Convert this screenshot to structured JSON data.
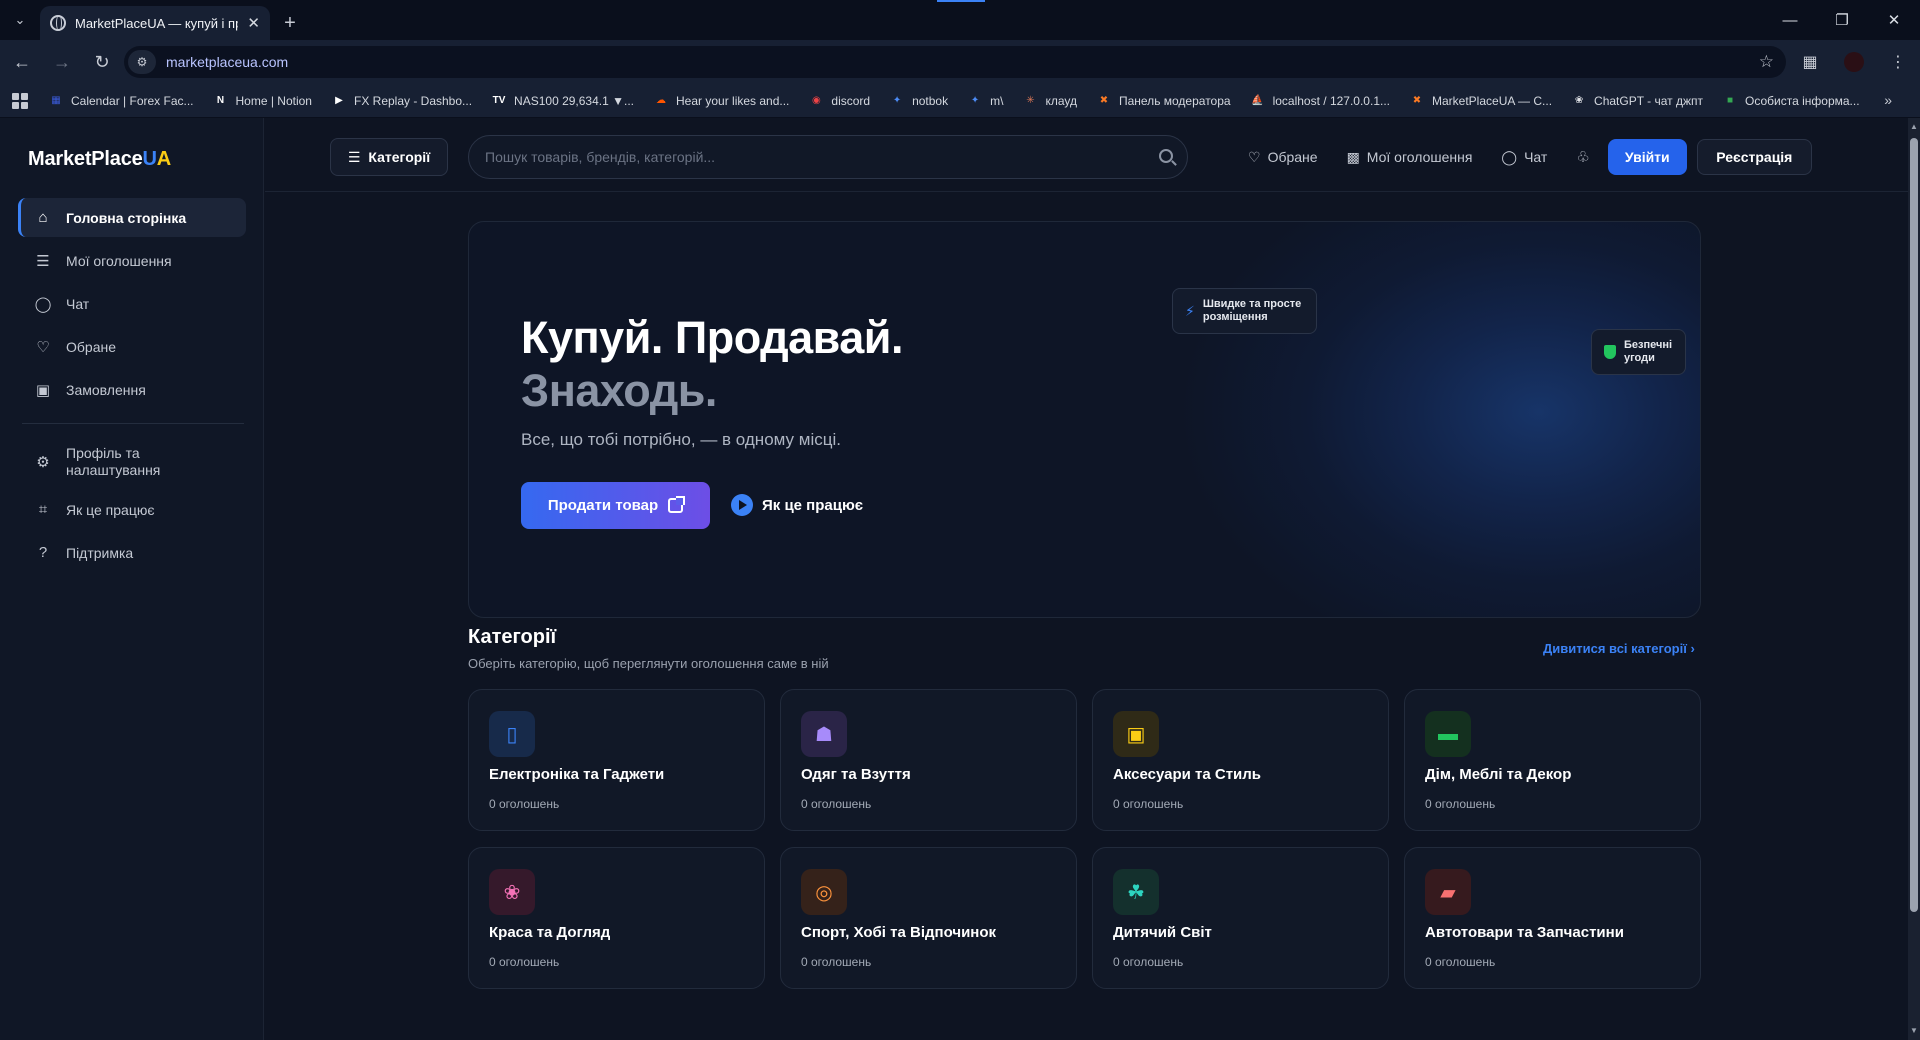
{
  "browser": {
    "tab_title": "MarketPlaceUA — купуй і продавай",
    "url": "marketplaceua.com",
    "bookmarks": [
      {
        "label": "Calendar | Forex Fac...",
        "icon": "calendar-icon",
        "color": "#3b5bdb"
      },
      {
        "label": "Home | Notion",
        "icon": "notion-icon",
        "color": "#ffffff"
      },
      {
        "label": "FX Replay - Dashbo...",
        "icon": "fxreplay-icon",
        "color": "#ffffff"
      },
      {
        "label": "NAS100 29,634.1 ▼...",
        "icon": "tradingview-icon",
        "color": "#ffffff"
      },
      {
        "label": "Hear your likes and...",
        "icon": "soundcloud-icon",
        "color": "#ff5500"
      },
      {
        "label": "discord",
        "icon": "discord-icon",
        "color": "#ed4245"
      },
      {
        "label": "notbok",
        "icon": "sparkle-icon",
        "color": "#4c8bf5"
      },
      {
        "label": "m\\",
        "icon": "sparkle-icon",
        "color": "#4c8bf5"
      },
      {
        "label": "клауд",
        "icon": "claude-icon",
        "color": "#d97757"
      },
      {
        "label": "Панель модератора",
        "icon": "xampp-icon",
        "color": "#fb7a24"
      },
      {
        "label": "localhost / 127.0.0.1...",
        "icon": "phpmyadmin-icon",
        "color": "#f89c0e"
      },
      {
        "label": "MarketPlaceUA — С...",
        "icon": "xampp-icon",
        "color": "#fb7a24"
      },
      {
        "label": "ChatGPT - чат джпт",
        "icon": "chatgpt-icon",
        "color": "#e5e7eb"
      },
      {
        "label": "Особиста інформа...",
        "icon": "google-icon",
        "color": "#34a853"
      }
    ]
  },
  "logo": {
    "part1": "MarketPlace",
    "part2": "U",
    "part3": "A"
  },
  "sidebar": {
    "items": [
      {
        "label": "Головна сторінка",
        "icon": "home-icon",
        "active": true
      },
      {
        "label": "Мої оголошення",
        "icon": "list-icon",
        "active": false
      },
      {
        "label": "Чат",
        "icon": "chat-icon",
        "active": false
      },
      {
        "label": "Обране",
        "icon": "heart-icon",
        "active": false
      },
      {
        "label": "Замовлення",
        "icon": "bag-icon",
        "active": false
      }
    ],
    "secondary": [
      {
        "label": "Профіль та налаштування",
        "icon": "gear-icon"
      },
      {
        "label": "Як це працює",
        "icon": "book-icon"
      },
      {
        "label": "Підтримка",
        "icon": "help-icon"
      }
    ]
  },
  "topbar": {
    "categories_label": "Категорії",
    "search_placeholder": "Пошук товарів, брендів, категорій...",
    "favorites_label": "Обране",
    "my_listings_label": "Мої оголошення",
    "chat_label": "Чат",
    "login_label": "Увійти",
    "register_label": "Реєстрація"
  },
  "hero": {
    "title_line1": "Купуй. Продавай.",
    "title_line2": "Знаходь.",
    "subtitle": "Все, що тобі потрібно, — в одному місці.",
    "sell_label": "Продати товар",
    "how_label": "Як це працює",
    "badge_fast": "Швидке та просте розміщення",
    "badge_safe": "Безпечні угоди"
  },
  "categories": {
    "title": "Категорії",
    "subtitle": "Оберіть категорію, щоб переглянути оголошення саме в ній",
    "view_all": "Дивитися всі категорії",
    "items": [
      {
        "name": "Електроніка та Гаджети",
        "count": "0 оголошень",
        "icon": "phone-icon",
        "color": "#3b82f6",
        "bg": "#172a4a"
      },
      {
        "name": "Одяг та Взуття",
        "count": "0 оголошень",
        "icon": "tshirt-icon",
        "color": "#a78bfa",
        "bg": "#2a2447"
      },
      {
        "name": "Аксесуари та Стиль",
        "count": "0 оголошень",
        "icon": "shopping-bag-icon",
        "color": "#facc15",
        "bg": "#2f2a17"
      },
      {
        "name": "Дім, Меблі та Декор",
        "count": "0 оголошень",
        "icon": "sofa-icon",
        "color": "#22c55e",
        "bg": "#14301f"
      },
      {
        "name": "Краса та Догляд",
        "count": "0 оголошень",
        "icon": "lotus-icon",
        "color": "#f472b6",
        "bg": "#35192b"
      },
      {
        "name": "Спорт, Хобі та Відпочинок",
        "count": "0 оголошень",
        "icon": "ball-icon",
        "color": "#fb923c",
        "bg": "#35221a"
      },
      {
        "name": "Дитячий Світ",
        "count": "0 оголошень",
        "icon": "stroller-icon",
        "color": "#2dd4bf",
        "bg": "#14302d"
      },
      {
        "name": "Автотовари та Запчастини",
        "count": "0 оголошень",
        "icon": "car-icon",
        "color": "#f87171",
        "bg": "#361a1e"
      }
    ]
  }
}
